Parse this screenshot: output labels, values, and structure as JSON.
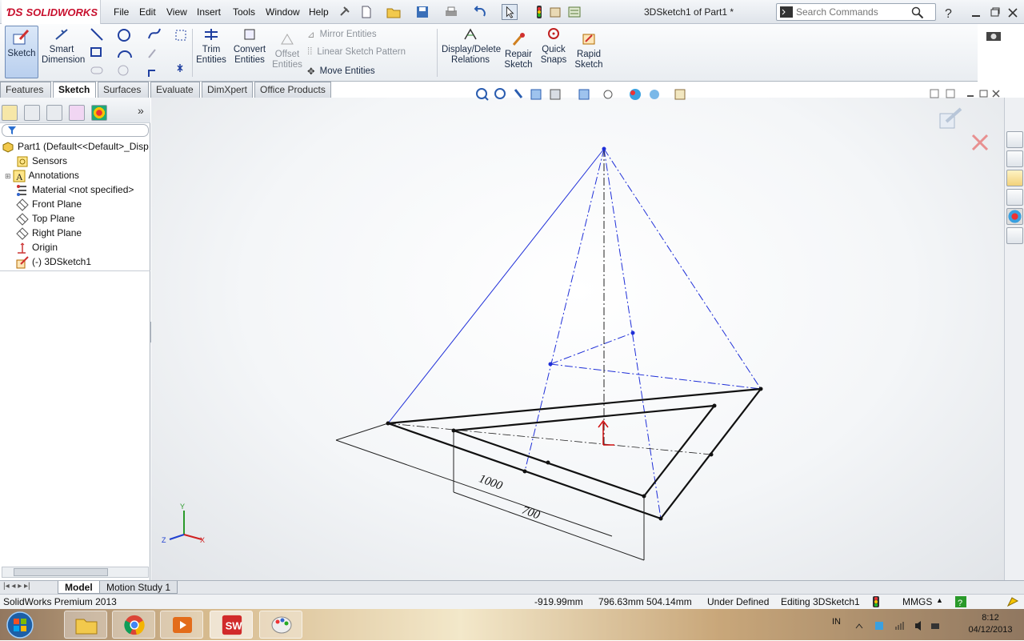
{
  "app": {
    "brand": "SOLIDWORKS",
    "doc_title": "3DSketch1 of Part1 *"
  },
  "menu": [
    "File",
    "Edit",
    "View",
    "Insert",
    "Tools",
    "Window",
    "Help"
  ],
  "search": {
    "placeholder": "Search Commands"
  },
  "command_manager": {
    "sketch": "Sketch",
    "smart_dimension": [
      "Smart",
      "Dimension"
    ],
    "trim_entities": [
      "Trim",
      "Entities"
    ],
    "convert_entities": [
      "Convert",
      "Entities"
    ],
    "offset_entities": [
      "Offset",
      "Entities"
    ],
    "mirror_entities": "Mirror Entities",
    "linear_sketch_pattern": "Linear Sketch Pattern",
    "move_entities": "Move Entities",
    "display_delete_relations": [
      "Display/Delete",
      "Relations"
    ],
    "repair_sketch": [
      "Repair",
      "Sketch"
    ],
    "quick_snaps": [
      "Quick",
      "Snaps"
    ],
    "rapid_sketch": [
      "Rapid",
      "Sketch"
    ]
  },
  "tabs": [
    "Features",
    "Sketch",
    "Surfaces",
    "Evaluate",
    "DimXpert",
    "Office Products"
  ],
  "active_tab": "Sketch",
  "feature_tree": {
    "root": "Part1  (Default<<Default>_Disp",
    "items": [
      "Sensors",
      "Annotations",
      "Material <not specified>",
      "Front Plane",
      "Top Plane",
      "Right Plane",
      "Origin",
      "(-) 3DSketch1"
    ]
  },
  "graphics": {
    "dim_1": "1000",
    "dim_2": "700",
    "triad": {
      "x": "X",
      "y": "Y",
      "z": "Z"
    }
  },
  "bottom_tabs": [
    "Model",
    "Motion Study 1"
  ],
  "status": {
    "product": "SolidWorks Premium 2013",
    "coord_x": "-919.99mm",
    "coord_yz": "796.63mm 504.14mm",
    "define_state": "Under Defined",
    "mode": "Editing 3DSketch1",
    "units": "MMGS"
  },
  "taskbar": {
    "lang": "IN",
    "time": "8:12",
    "date": "04/12/2013"
  },
  "colors": {
    "sketch_blue": "#1f2fd8",
    "sketch_black": "#111111",
    "brand_red": "#c8102e"
  }
}
